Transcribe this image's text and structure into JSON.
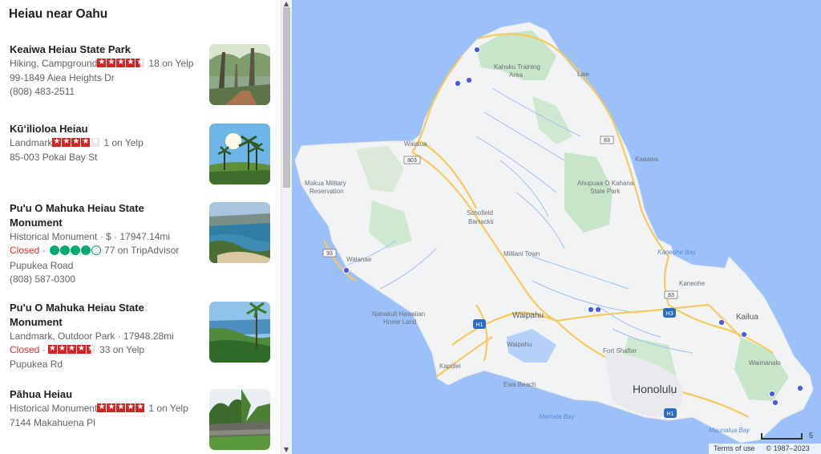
{
  "panel": {
    "title": "Heiau near Oahu",
    "items": [
      {
        "name": "Keaiwa Heiau State Park",
        "category": "Hiking, Campground",
        "rating_source": "yelp",
        "rating": 4.5,
        "review_text": "18 on Yelp",
        "address": "99-1849 Aiea Heights Dr",
        "phone": "(808) 483-2511",
        "image": "forest-photo"
      },
      {
        "name": "Kūʻilioloa Heiau",
        "category": "Landmark",
        "rating_source": "yelp",
        "rating": 4,
        "review_text": "1 on Yelp",
        "address": "85-003 Pokai Bay St",
        "image": "palm-beach-photo"
      },
      {
        "name_line1": "Pu'u O Mahuka Heiau State",
        "name_line2": "Monument",
        "category": "Historical Monument · $ · 17947.14mi",
        "status": "Closed",
        "status_sep": " · ",
        "rating_source": "tripadvisor",
        "rating": 4,
        "review_text": "77 on TripAdvisor",
        "address": "Pupukea Road",
        "phone": "(808) 587-0300",
        "image": "coast-bay-photo"
      },
      {
        "name_line1": "Pu'u O Mahuka Heiau State",
        "name_line2": "Monument",
        "category": "Landmark, Outdoor Park · 17948.28mi",
        "status": "Closed",
        "status_sep": " · ",
        "rating_source": "yelp",
        "rating": 4.5,
        "review_text": "33 on Yelp",
        "address": "Pupukea Rd",
        "image": "green-coast-photo"
      },
      {
        "name": "Pāhua Heiau",
        "category": "Historical Monument",
        "rating_source": "yelp",
        "rating": 5,
        "review_text": "1 on Yelp",
        "address": "7144 Makahuena Pl",
        "image": "ruins-photo"
      }
    ]
  },
  "map": {
    "labels": {
      "kahuku": "Kahuku Training",
      "kahuku2": "Area",
      "laie": "Laie",
      "waialua": "Waialua",
      "kaaawa": "Kaaawa",
      "makua1": "Makua Military",
      "makua2": "Reservation",
      "ahupuaa1": "Ahupuaa O Kahana",
      "ahupuaa2": "State Park",
      "schofield1": "Schofield",
      "schofield2": "Barracks",
      "waianae": "Waianae",
      "mililani": "Mililani Town",
      "kaneohe_bay": "Kaneohe Bay",
      "kaneohe": "Kaneohe",
      "nanakuli1": "Nanakuli Hawaiian",
      "nanakuli2": "Home Land",
      "waipahu": "Waipahu",
      "kailua": "Kailua",
      "fort_shafter": "Fort Shafter",
      "waipahu_small": "Waipahu",
      "waimanalo": "Waimanalo",
      "kapolei": "Kapolei",
      "honolulu": "Honolulu",
      "ewa": "Ewa Beach",
      "mamala": "Mamala Bay",
      "maunalua": "Maunalua Bay"
    },
    "shields": {
      "r83a": "83",
      "r803": "803",
      "r83b": "83",
      "r93": "93",
      "h1a": "H1",
      "h3": "H3",
      "h1b": "H1"
    },
    "footer": {
      "terms": "Terms of use",
      "copyright": "© 1987–2023"
    },
    "scale_text": "5",
    "colors": {
      "water": "#9cc0f9",
      "land": "#f1f3f4",
      "park": "#c7e5c9",
      "road": "#f7c95b",
      "pin": "#4a5ae8"
    }
  }
}
